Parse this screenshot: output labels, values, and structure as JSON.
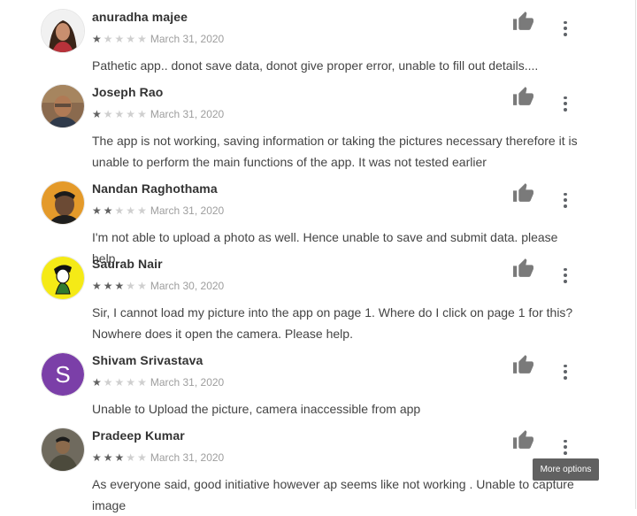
{
  "reviews": [
    {
      "author": "anuradha majee",
      "rating": 1,
      "date": "March 31, 2020",
      "text": "Pathetic app.. donot save data, donot give proper error, unable to fill out details....",
      "avatar": "photo"
    },
    {
      "author": "Joseph Rao",
      "rating": 1,
      "date": "March 31, 2020",
      "text": "The app is not working, saving information or taking the pictures necessary therefore it is unable to perform the main functions of the app. It was not tested earlier",
      "avatar": "photo"
    },
    {
      "author": "Nandan Raghothama",
      "rating": 2,
      "date": "March 31, 2020",
      "text": "I'm not able to upload a photo as well. Hence unable to save and submit data. please help.",
      "avatar": "photo"
    },
    {
      "author": "Saurab Nair",
      "rating": 3,
      "date": "March 30, 2020",
      "text": "Sir, I cannot load my picture into the app on page 1. Where do I click on page 1 for this? Nowhere does it open the camera. Please help.",
      "avatar": "cartoon"
    },
    {
      "author": "Shivam Srivastava",
      "rating": 1,
      "date": "March 31, 2020",
      "text": "Unable to Upload the picture, camera inaccessible from app",
      "avatar": "letter",
      "avatar_letter": "S",
      "avatar_color": "#7b3fa8"
    },
    {
      "author": "Pradeep Kumar",
      "rating": 3,
      "date": "March 31, 2020",
      "text": "As everyone said, good initiative however ap seems like not working . Unable to capture image",
      "avatar": "photo"
    }
  ],
  "tooltip": {
    "label": "More options"
  },
  "colors": {
    "star_on": "#616161",
    "star_off": "#cfcfcf",
    "tooltip_bg": "#616161"
  },
  "icons": {
    "helpful": "thumbs-up-icon",
    "menu": "more-vert-icon",
    "star": "star-icon"
  }
}
